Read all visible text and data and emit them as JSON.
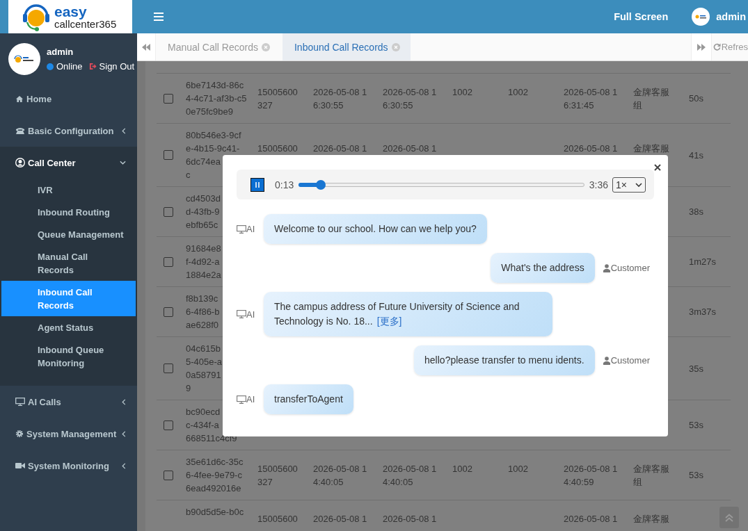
{
  "logo": {
    "line1": "easy",
    "line2": "callcenter365"
  },
  "user": {
    "name": "admin",
    "status": "Online",
    "sign_out": "Sign Out"
  },
  "sidebar": {
    "menu": [
      {
        "label": "Home",
        "kind": "link"
      },
      {
        "label": "Basic Configuration",
        "kind": "group",
        "expanded": false
      },
      {
        "label": "Call Center",
        "kind": "group",
        "expanded": true,
        "children": [
          {
            "label": "IVR",
            "selected": false
          },
          {
            "label": "Inbound Routing",
            "selected": false
          },
          {
            "label": "Queue Management",
            "selected": false
          },
          {
            "label": "Manual Call Records",
            "selected": false
          },
          {
            "label": "Inbound Call Records",
            "selected": true
          },
          {
            "label": "Agent Status",
            "selected": false
          },
          {
            "label": "Inbound Queue Monitoring",
            "selected": false
          }
        ]
      },
      {
        "label": "AI Calls",
        "kind": "group",
        "expanded": false
      },
      {
        "label": "System Management",
        "kind": "group",
        "expanded": false
      },
      {
        "label": "System Monitoring",
        "kind": "group",
        "expanded": false
      }
    ]
  },
  "topbar": {
    "full_screen": "Full Screen",
    "user": "admin"
  },
  "tabs": [
    {
      "label": "Manual Call Records",
      "selected": false
    },
    {
      "label": "Inbound Call Records",
      "selected": true
    }
  ],
  "refresh": "Refres",
  "table": {
    "rows": [
      {
        "checked": false,
        "column_2": "6be7143d-86c4-4c71-af3b-c50e75fc9be9",
        "column_3": "15005600327",
        "column_4": "2026-05-08 16:30:55",
        "column_5": "2026-05-08 16:30:55",
        "column_6": "1002",
        "column_7": "1002",
        "column_8": "2026-05-08 16:31:45",
        "column_9": "金牌客服组",
        "column_10": "50s"
      },
      {
        "checked": false,
        "column_2": "80b546e3-9cf\ne-4b15-9c41-\n6dc74ea\nc",
        "column_3": "15005600",
        "column_4": "2026-05-08 1",
        "column_5": "2026-05-08 1",
        "column_8": "2026-05-08 1",
        "column_9": "金牌客服",
        "column_10": "41s"
      },
      {
        "checked": false,
        "column_2": "cd4503d\nd-43fb-9\nebfb65c",
        "column_10": "38s"
      },
      {
        "checked": false,
        "column_2": "91684e8\nf-4d92-a\n1884e2a",
        "column_10": "1m27s"
      },
      {
        "checked": false,
        "column_2": "f8b139c\n6-4f86-b\nae628f0",
        "column_10": "3m37s"
      },
      {
        "checked": false,
        "column_2": "04c615b\n5-405e-a\n0a58791\n9",
        "column_10": "35s"
      },
      {
        "checked": false,
        "column_2": "bc90ecd\nc-434f-a\n668511c4cf9",
        "column_10": "53s"
      },
      {
        "checked": false,
        "column_2": "35e61d6c-35c6-4fee-9e79-c6ead492016e",
        "column_3": "15005600327",
        "column_4": "2026-05-08 14:40:05",
        "column_5": "2026-05-08 14:40:05",
        "column_6": "1002",
        "column_7": "1002",
        "column_8": "2026-05-08 14:40:59",
        "column_9": "金牌客服组",
        "column_10": "53s"
      },
      {
        "column_2": "b90d5d5e-b0c",
        "column_3": "15005600",
        "column_4": "2026-05-08 1",
        "column_5": "2026-05-08 1",
        "column_8": "2026-05-08 1",
        "column_9": "金牌客服"
      }
    ]
  },
  "dialog": {
    "player": {
      "playing": true,
      "current": "0:13",
      "total": "3:36",
      "level": 0.078,
      "speed": "1×"
    },
    "messages": [
      {
        "kind": "ai",
        "speaker": "AI",
        "text": "Welcome to our school. How can we help you?"
      },
      {
        "kind": "customer",
        "speaker": "Customer",
        "text": "What's the address"
      },
      {
        "kind": "ai",
        "speaker": "AI",
        "text": "The campus address of Future University of Science and Technology is No. 18...",
        "more_link": "[更多]"
      },
      {
        "kind": "customer",
        "speaker": "Customer",
        "text": "hello?please transfer to menu idents."
      },
      {
        "kind": "ai",
        "speaker": "AI",
        "text": "transferToAgent"
      }
    ]
  }
}
